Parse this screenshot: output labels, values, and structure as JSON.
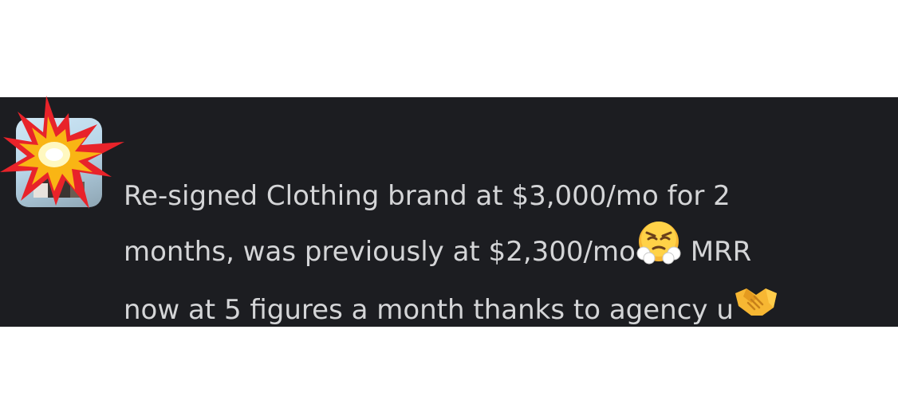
{
  "message": {
    "line1": "Re-signed Clothing brand at $3,000/mo for 2",
    "line2_before": "months, was previously at $2,300/mo",
    "line2_after": " MRR",
    "line3_before": "now at 5 figures a month thanks to agency u"
  },
  "icons": {
    "avatar_badge": "collision-emoji",
    "emoji_1": "face-with-steam-from-nose-emoji",
    "emoji_2": "handshake-emoji"
  },
  "colors": {
    "panel_background": "#1c1d21",
    "text": "#d4d5d7"
  }
}
